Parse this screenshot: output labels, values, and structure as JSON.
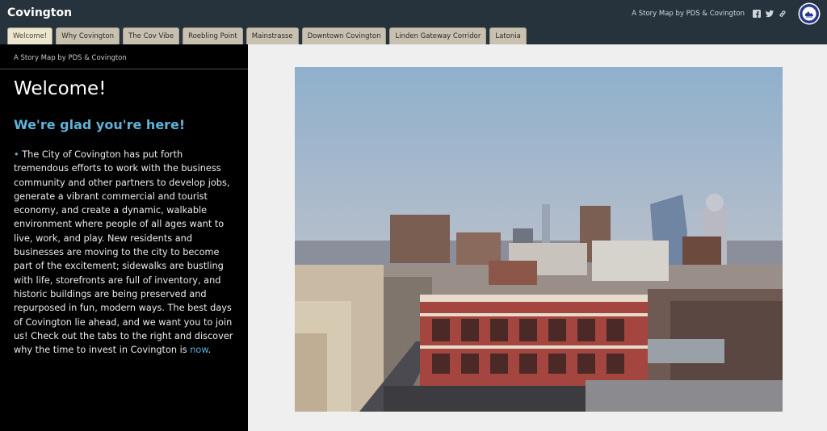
{
  "header": {
    "app_title": "Covington",
    "story_map_link": "A Story Map by PDS & Covington",
    "icons": [
      "facebook-icon",
      "twitter-icon",
      "share-link-icon",
      "city-seal-logo"
    ]
  },
  "tabs": [
    {
      "label": "Welcome!",
      "active": true
    },
    {
      "label": "Why Covington",
      "active": false
    },
    {
      "label": "The Cov Vibe",
      "active": false
    },
    {
      "label": "Roebling Point",
      "active": false
    },
    {
      "label": "Mainstrasse",
      "active": false
    },
    {
      "label": "Downtown Covington",
      "active": false
    },
    {
      "label": "Linden Gateway Corridor",
      "active": false
    },
    {
      "label": "Latonia",
      "active": false
    }
  ],
  "panel": {
    "subtitle": "A Story Map by PDS & Covington",
    "heading": "Welcome!",
    "subheading": "We're glad you're here!",
    "bullet": "•",
    "body": "The City of Covington has put forth tremendous efforts to work with the business community and other partners to develop jobs, generate a vibrant commercial and tourist economy, and create a dynamic, walkable environment where people of all ages want to live, work, and play. New residents and businesses are moving to the city to become part of the excitement; sidewalks are bustling with life, storefronts are full of inventory, and historic buildings are being preserved and repurposed in fun, modern ways. The best days of Covington lie ahead, and we want you to join us! Check out the tabs to the right and discover why the time to invest in Covington is ",
    "body_link": "now",
    "body_end": "."
  },
  "colors": {
    "topbar": "#27333c",
    "tab": "#c9c1b0",
    "tab_active": "#ece6cf",
    "panel_bg": "#000000",
    "accent": "#5fb3d9"
  }
}
